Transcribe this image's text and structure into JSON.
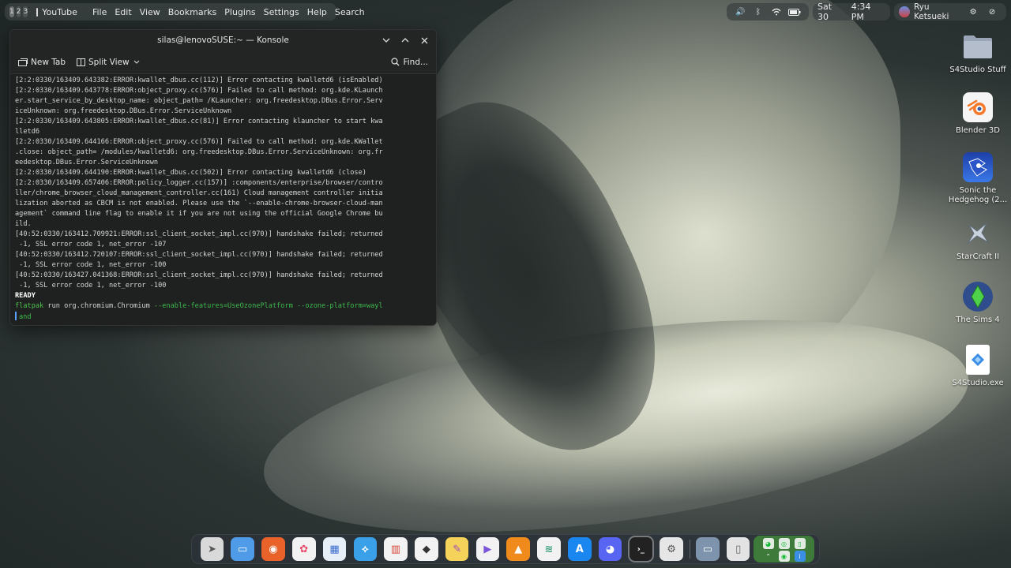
{
  "topbar": {
    "virtual_desktops": [
      "1",
      "2",
      "3"
    ],
    "active_app": "YouTube",
    "menu": [
      "File",
      "Edit",
      "View",
      "Bookmarks",
      "Plugins",
      "Settings",
      "Help",
      "Search"
    ],
    "clock": {
      "day": "Sat 30",
      "time": "4:34 PM"
    },
    "user": "Ryu Ketsueki"
  },
  "konsole": {
    "title": "silas@lenovoSUSE:~ — Konsole",
    "new_tab": "New Tab",
    "split_view": "Split View",
    "find": "Find...",
    "lines": [
      "[2:2:0330/163409.643382:ERROR:kwallet_dbus.cc(112)] Error contacting kwalletd6 (isEnabled)",
      "[2:2:0330/163409.643778:ERROR:object_proxy.cc(576)] Failed to call method: org.kde.KLaunch",
      "er.start_service_by_desktop_name: object_path= /KLauncher: org.freedesktop.DBus.Error.Serv",
      "iceUnknown: org.freedesktop.DBus.Error.ServiceUnknown",
      "[2:2:0330/163409.643805:ERROR:kwallet_dbus.cc(81)] Error contacting klauncher to start kwa",
      "lletd6",
      "[2:2:0330/163409.644166:ERROR:object_proxy.cc(576)] Failed to call method: org.kde.KWallet",
      ".close: object_path= /modules/kwalletd6: org.freedesktop.DBus.Error.ServiceUnknown: org.fr",
      "eedesktop.DBus.Error.ServiceUnknown",
      "[2:2:0330/163409.644190:ERROR:kwallet_dbus.cc(502)] Error contacting kwalletd6 (close)",
      "[2:2:0330/163409.657406:ERROR:policy_logger.cc(157)] :components/enterprise/browser/contro",
      "ller/chrome_browser_cloud_management_controller.cc(161) Cloud management controller initia",
      "lization aborted as CBCM is not enabled. Please use the `--enable-chrome-browser-cloud-man",
      "agement` command line flag to enable it if you are not using the official Google Chrome bu",
      "ild.",
      "[40:52:0330/163412.709921:ERROR:ssl_client_socket_impl.cc(970)] handshake failed; returned",
      " -1, SSL error code 1, net_error -107",
      "[40:52:0330/163412.720107:ERROR:ssl_client_socket_impl.cc(970)] handshake failed; returned",
      " -1, SSL error code 1, net_error -100",
      "[40:52:0330/163427.041368:ERROR:ssl_client_socket_impl.cc(970)] handshake failed; returned",
      " -1, SSL error code 1, net_error -100"
    ],
    "ready": "READY",
    "command": {
      "bin": "flatpak",
      "args": " run org.chromium.Chromium ",
      "flags": "--enable-features=UseOzonePlatform --ozone-platform=wayl",
      "wrap": "and"
    }
  },
  "desktop_icons": [
    {
      "label": "S4Studio Stuff",
      "icon": "folder-icon",
      "color": "#9aa6b8"
    },
    {
      "label": "Blender 3D",
      "icon": "blender-icon",
      "color": "#f5f5f5"
    },
    {
      "label": "Sonic the Hedgehog (2...",
      "icon": "sonic-icon",
      "color": "#2b56c9"
    },
    {
      "label": "StarCraft II",
      "icon": "starcraft-icon",
      "color": "#5d6b7a"
    },
    {
      "label": "The Sims 4",
      "icon": "sims-icon",
      "color": "#2f4d8c"
    },
    {
      "label": "S4Studio.exe",
      "icon": "s4studio-icon",
      "color": "#ffffff"
    }
  ],
  "dock": {
    "apps": [
      {
        "name": "launchpad",
        "color": "#d9d9d9",
        "glyph": "➤"
      },
      {
        "name": "files",
        "color": "#4f9be8",
        "glyph": "▭"
      },
      {
        "name": "firefox",
        "color": "#e8622a",
        "glyph": "◉"
      },
      {
        "name": "photos",
        "color": "#f2f2f2",
        "glyph": "✿"
      },
      {
        "name": "system-settings",
        "color": "#e6eef7",
        "glyph": "▦"
      },
      {
        "name": "kde-connect",
        "color": "#3aa0e8",
        "glyph": "⟡"
      },
      {
        "name": "office",
        "color": "#f2f2f2",
        "glyph": "▥"
      },
      {
        "name": "inkscape",
        "color": "#f2f2f2",
        "glyph": "◆"
      },
      {
        "name": "krita",
        "color": "#f5d35a",
        "glyph": "✎"
      },
      {
        "name": "media-player",
        "color": "#f2f2f2",
        "glyph": "▶"
      },
      {
        "name": "vlc",
        "color": "#f08a1c",
        "glyph": "▲"
      },
      {
        "name": "layers",
        "color": "#f2f2f2",
        "glyph": "≋"
      },
      {
        "name": "app-store",
        "color": "#1a86f0",
        "glyph": "A"
      },
      {
        "name": "discord",
        "color": "#5865f2",
        "glyph": "◕"
      },
      {
        "name": "terminal",
        "color": "#222222",
        "glyph": "›_"
      },
      {
        "name": "system-monitor",
        "color": "#e6e6e6",
        "glyph": "⚙"
      },
      {
        "name": "downloads-folder",
        "color": "#7e94ad",
        "glyph": "▭"
      },
      {
        "name": "trash",
        "color": "#e3e3e3",
        "glyph": "▯"
      }
    ]
  }
}
